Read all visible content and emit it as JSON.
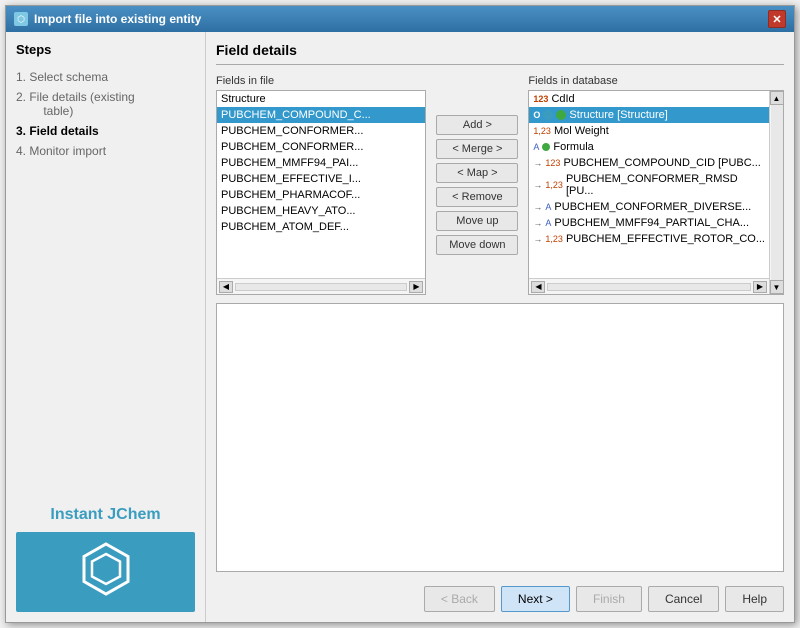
{
  "window": {
    "title": "Import file into existing entity",
    "close_label": "✕"
  },
  "sidebar": {
    "title": "Steps",
    "steps": [
      {
        "number": "1.",
        "label": "Select schema",
        "state": "inactive"
      },
      {
        "number": "2.",
        "label": "File details (existing table)",
        "state": "inactive"
      },
      {
        "number": "3.",
        "label": "Field details",
        "state": "active"
      },
      {
        "number": "4.",
        "label": "Monitor import",
        "state": "inactive"
      }
    ],
    "logo_text": "Instant JChem"
  },
  "main": {
    "title": "Field details",
    "fields_in_file_label": "Fields in file",
    "fields_in_database_label": "Fields in database",
    "file_fields": [
      "Structure",
      "PUBCHEM_COMPOUND_C...",
      "PUBCHEM_CONFORMER...",
      "PUBCHEM_CONFORMER...",
      "PUBCHEM_MMFF94_PAI...",
      "PUBCHEM_EFFECTIVE_I...",
      "PUBCHEM_PHARMACOF...",
      "PUBCHEM_HEAVY_ATO...",
      "PUBCHEM_ATOM_DEF..."
    ],
    "db_fields": [
      {
        "type": "123",
        "icon": "none",
        "label": "CdId"
      },
      {
        "type": "O",
        "icon": "circle",
        "label": "Structure [Structure]"
      },
      {
        "type": "1,23",
        "icon": "none",
        "label": "Mol Weight"
      },
      {
        "type": "A",
        "icon": "formula",
        "label": "Formula"
      },
      {
        "type": "→123",
        "icon": "none",
        "label": "PUBCHEM_COMPOUND_CID [PUBC..."
      },
      {
        "type": "→1,23",
        "icon": "none",
        "label": "PUBCHEM_CONFORMER_RMSD [PU..."
      },
      {
        "type": "→A",
        "icon": "none",
        "label": "PUBCHEM_CONFORMER_DIVERSE..."
      },
      {
        "type": "→A",
        "icon": "none",
        "label": "PUBCHEM_MMFF94_PARTIAL_CHA..."
      },
      {
        "type": "→1,23",
        "icon": "none",
        "label": "PUBCHEM_EFFECTIVE_ROTOR_CO..."
      }
    ],
    "buttons": {
      "add": "Add >",
      "merge": "< Merge >",
      "map": "< Map >",
      "remove": "< Remove",
      "move_up": "Move up",
      "move_down": "Move down"
    },
    "bottom_buttons": {
      "back": "< Back",
      "next": "Next >",
      "finish": "Finish",
      "cancel": "Cancel",
      "help": "Help"
    }
  }
}
